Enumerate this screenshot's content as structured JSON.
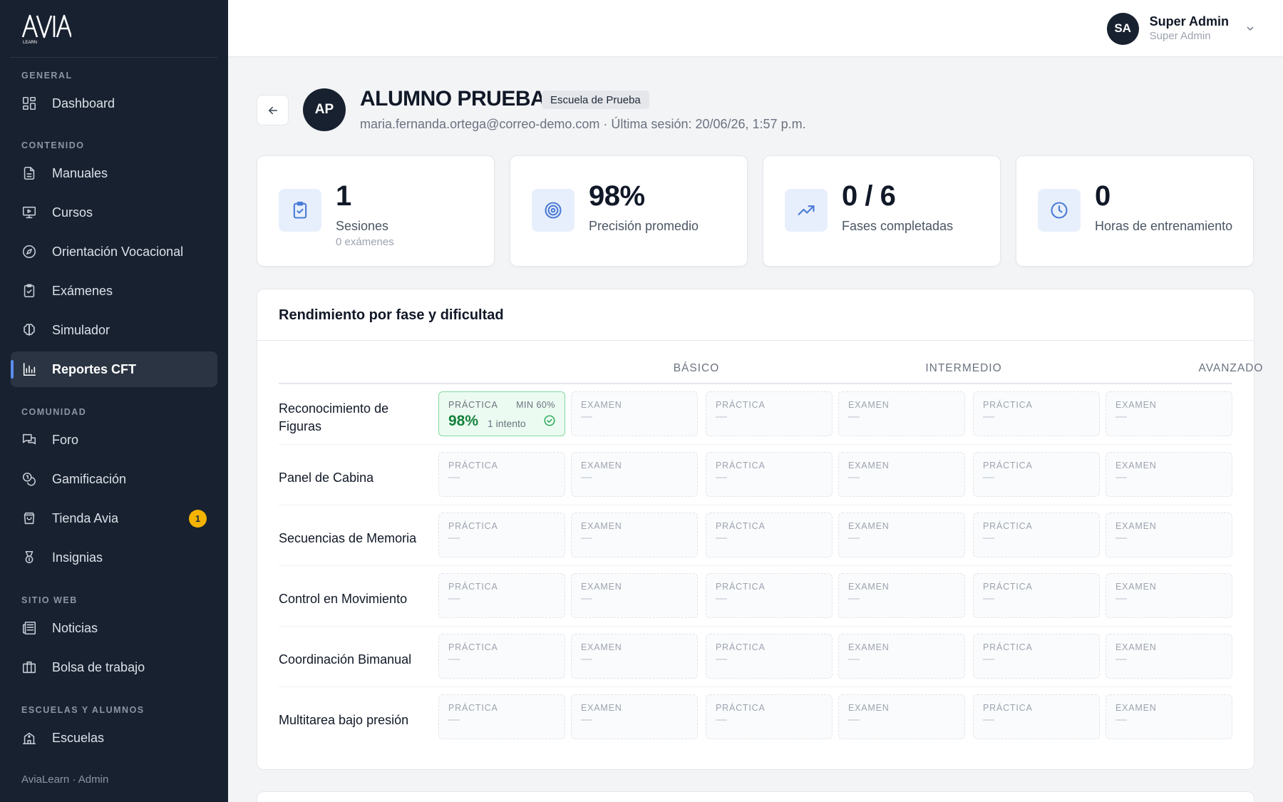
{
  "sidebar": {
    "brand": "AVIA",
    "brand_sub": "LEARN",
    "sections": {
      "general": "GENERAL",
      "contenido": "CONTENIDO",
      "comunidad": "COMUNIDAD",
      "sitio_web": "SITIO WEB",
      "escuelas": "ESCUELAS Y ALUMNOS"
    },
    "items": {
      "dashboard": "Dashboard",
      "manuales": "Manuales",
      "cursos": "Cursos",
      "orientacion": "Orientación Vocacional",
      "examenes": "Exámenes",
      "simulador": "Simulador",
      "reportes": "Reportes CFT",
      "foro": "Foro",
      "gamificacion": "Gamificación",
      "tienda": "Tienda Avia",
      "insignias": "Insignias",
      "noticias": "Noticias",
      "bolsa": "Bolsa de trabajo",
      "escuelas": "Escuelas"
    },
    "tienda_badge": "1",
    "footer": "AviaLearn · Admin",
    "active_item": "reportes",
    "accent_color": "#5b8def",
    "badge_color": "#f5b301"
  },
  "topbar": {
    "user_initials": "SA",
    "user_name": "Super Admin",
    "user_role": "Super Admin"
  },
  "student": {
    "initials": "AP",
    "name": "ALUMNO PRUEBA",
    "school": "Escuela de Prueba",
    "meta": "maria.fernanda.ortega@correo-demo.com · Última sesión: 20/06/26, 1:57 p.m."
  },
  "stats": [
    {
      "icon": "clipboard-check-icon",
      "value": "1",
      "label": "Sesiones",
      "sub": "0 exámenes"
    },
    {
      "icon": "target-icon",
      "value": "98%",
      "label": "Precisión promedio",
      "sub": ""
    },
    {
      "icon": "trending-up-icon",
      "value": "0 / 6",
      "label": "Fases completadas",
      "sub": ""
    },
    {
      "icon": "clock-icon",
      "value": "0",
      "label": "Horas de entrenamiento",
      "sub": ""
    }
  ],
  "performance": {
    "title": "Rendimiento por fase y dificultad",
    "levels": [
      "BÁSICO",
      "INTERMEDIO",
      "AVANZADO"
    ],
    "cell_types": {
      "practice": "PRÁCTICA",
      "exam": "EXAMEN"
    },
    "rows": [
      {
        "phase": "Reconocimiento de Figuras",
        "cells": [
          {
            "type": "PRÁCTICA",
            "min": "MIN 60%",
            "score": "98%",
            "attempts": "1 intento",
            "passed": true
          },
          {
            "type": "EXAMEN"
          },
          {
            "type": "PRÁCTICA"
          },
          {
            "type": "EXAMEN"
          },
          {
            "type": "PRÁCTICA"
          },
          {
            "type": "EXAMEN"
          }
        ]
      },
      {
        "phase": "Panel de Cabina",
        "cells": [
          {
            "type": "PRÁCTICA"
          },
          {
            "type": "EXAMEN"
          },
          {
            "type": "PRÁCTICA"
          },
          {
            "type": "EXAMEN"
          },
          {
            "type": "PRÁCTICA"
          },
          {
            "type": "EXAMEN"
          }
        ]
      },
      {
        "phase": "Secuencias de Memoria",
        "cells": [
          {
            "type": "PRÁCTICA"
          },
          {
            "type": "EXAMEN"
          },
          {
            "type": "PRÁCTICA"
          },
          {
            "type": "EXAMEN"
          },
          {
            "type": "PRÁCTICA"
          },
          {
            "type": "EXAMEN"
          }
        ]
      },
      {
        "phase": "Control en Movimiento",
        "cells": [
          {
            "type": "PRÁCTICA"
          },
          {
            "type": "EXAMEN"
          },
          {
            "type": "PRÁCTICA"
          },
          {
            "type": "EXAMEN"
          },
          {
            "type": "PRÁCTICA"
          },
          {
            "type": "EXAMEN"
          }
        ]
      },
      {
        "phase": "Coordinación Bimanual",
        "cells": [
          {
            "type": "PRÁCTICA"
          },
          {
            "type": "EXAMEN"
          },
          {
            "type": "PRÁCTICA"
          },
          {
            "type": "EXAMEN"
          },
          {
            "type": "PRÁCTICA"
          },
          {
            "type": "EXAMEN"
          }
        ]
      },
      {
        "phase": "Multitarea bajo presión",
        "cells": [
          {
            "type": "PRÁCTICA"
          },
          {
            "type": "EXAMEN"
          },
          {
            "type": "PRÁCTICA"
          },
          {
            "type": "EXAMEN"
          },
          {
            "type": "PRÁCTICA"
          },
          {
            "type": "EXAMEN"
          }
        ]
      }
    ],
    "pass_color": "#15803d"
  }
}
